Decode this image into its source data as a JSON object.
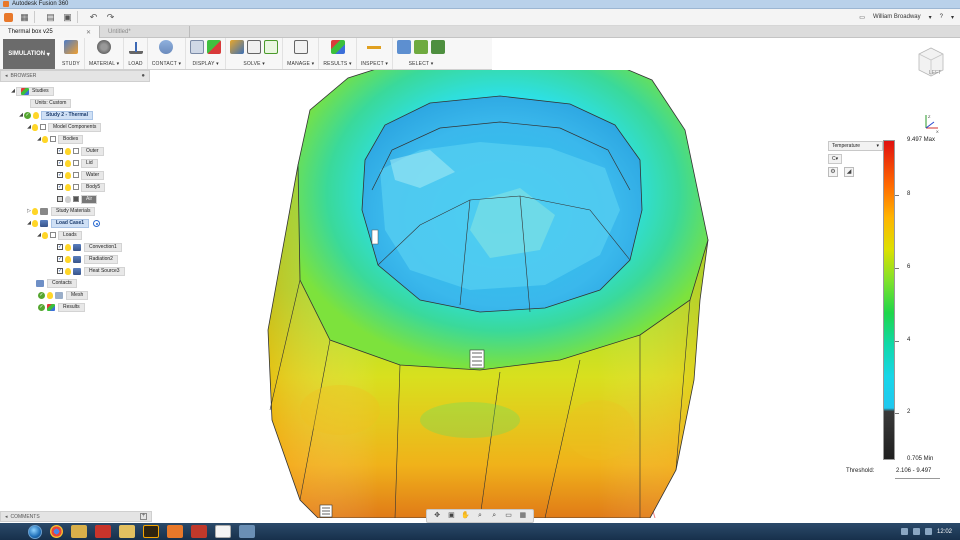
{
  "window": {
    "title": "Autodesk Fusion 360"
  },
  "user": {
    "name": "William Broadway"
  },
  "tabs": [
    {
      "label": "Thermal box v25",
      "active": true
    },
    {
      "label": "Untitled*",
      "active": false
    }
  ],
  "toolbar": {
    "workspace": "SIMULATION",
    "groups": [
      "STUDY",
      "MATERIAL",
      "LOAD",
      "CONTACT",
      "DISPLAY",
      "SOLVE",
      "MANAGE",
      "RESULTS",
      "INSPECT",
      "SELECT"
    ]
  },
  "browser": {
    "title": "BROWSER",
    "items": {
      "studies": "Studies",
      "units": "Units: Custom",
      "study": "Study 2 - Thermal",
      "model_components": "Model Components",
      "bodies": "Bodies",
      "outer": "Outer",
      "lid": "Lid",
      "water": "Water",
      "body5": "Body5",
      "air": "Air",
      "study_materials": "Study Materials",
      "load_case": "Load Case1",
      "loads": "Loads",
      "convection": "Convection1",
      "radiation": "Radiation2",
      "heat_source": "Heat Source3",
      "contacts": "Contacts",
      "mesh": "Mesh",
      "results": "Results"
    }
  },
  "comments": {
    "label": "COMMENTS"
  },
  "legend": {
    "result_type": "Temperature",
    "unit": "C",
    "max_label": "9.497 Max",
    "min_label": "0.705 Min",
    "ticks": [
      "8",
      "6",
      "4",
      "2"
    ],
    "threshold_label": "Threshold:",
    "threshold_value": "2.106 - 9.497",
    "colors": [
      "#e01010",
      "#ff6a00",
      "#ffb400",
      "#dde000",
      "#7fe12b",
      "#1fd64a",
      "#10d8a8",
      "#18d6e8",
      "#3a3a3a"
    ]
  },
  "viewcube": {
    "face": "LEFT"
  },
  "taskbar": {
    "time": "12:02"
  },
  "icons": {
    "app": "fusion-logo-icon",
    "grid": "data-panel-icon",
    "file": "file-icon",
    "save": "save-icon",
    "undo": "undo-icon",
    "redo": "redo-icon",
    "notification": "notification-icon",
    "help": "help-icon"
  }
}
